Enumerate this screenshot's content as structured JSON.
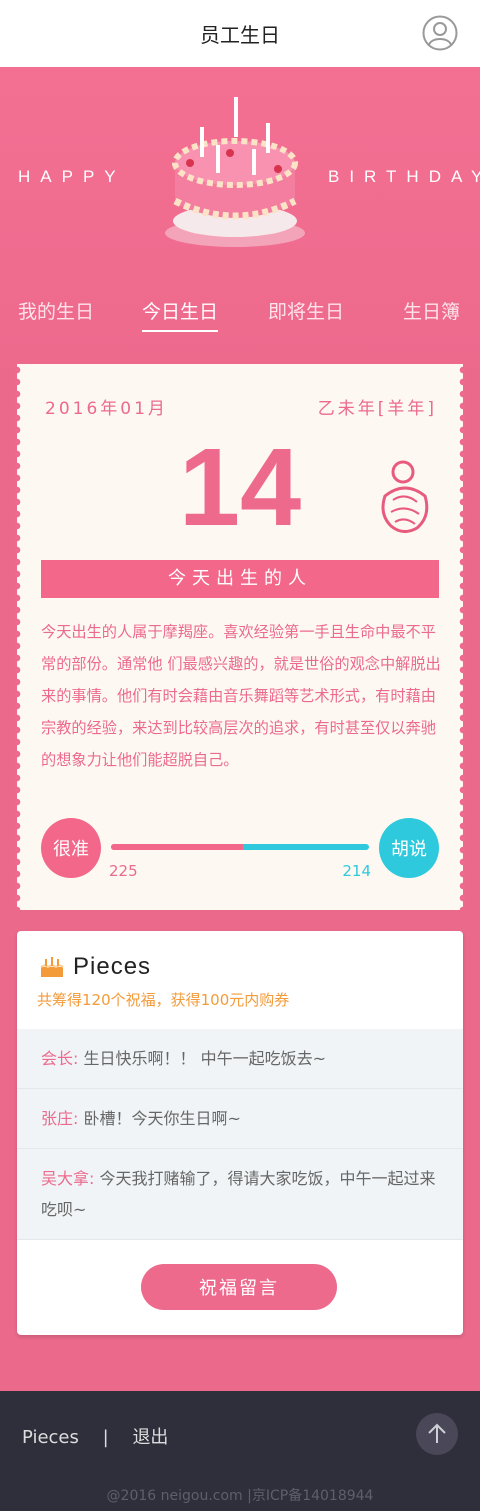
{
  "header": {
    "title": "员工生日"
  },
  "hero": {
    "word_left": "HAPPY",
    "word_right": "BIRTHDAY",
    "tabs": [
      {
        "label": "我的生日",
        "active": false
      },
      {
        "label": "今日生日",
        "active": true
      },
      {
        "label": "即将生日",
        "active": false
      },
      {
        "label": "生日簿",
        "active": false
      }
    ]
  },
  "ticket": {
    "date": "2016年01月",
    "year": "乙未年[羊年]",
    "day": "14",
    "bar_title": "今天出生的人",
    "description": "今天出生的人属于摩羯座。喜欢经验第一手且生命中最不平常的部份。通常他 们最感兴趣的，就是世俗的观念中解脱出来的事情。他们有时会藉由音乐舞蹈等艺术形式，有时藉由宗教的经验，来达到比较高层次的追求，有时甚至仅以奔驰的想象力让他们能超脱自己。",
    "vote_good_label": "很准",
    "vote_bad_label": "胡说",
    "good_count": "225",
    "bad_count": "214",
    "good_ratio": 0.5125
  },
  "pieces": {
    "title": "Pieces",
    "subtitle": "共筹得120个祝福，获得100元内购券",
    "messages": [
      {
        "who": "会长:",
        "text": "生日快乐啊！！ 中午一起吃饭去~"
      },
      {
        "who": "张庄:",
        "text": "卧槽！今天你生日啊~"
      },
      {
        "who": "吴大拿:",
        "text": "今天我打赌输了，得请大家吃饭，中午一起过来吃呗~"
      }
    ],
    "button": "祝福留言"
  },
  "footer": {
    "link1": "Pieces",
    "separator": "|",
    "link2": "退出",
    "copyright": "@2016 neigou.com |京ICP备14018944"
  },
  "colors": {
    "pink": "#ee6a8d",
    "cyan": "#2ec9dd",
    "orange": "#f39b3a",
    "footer": "#2f2e3b"
  }
}
